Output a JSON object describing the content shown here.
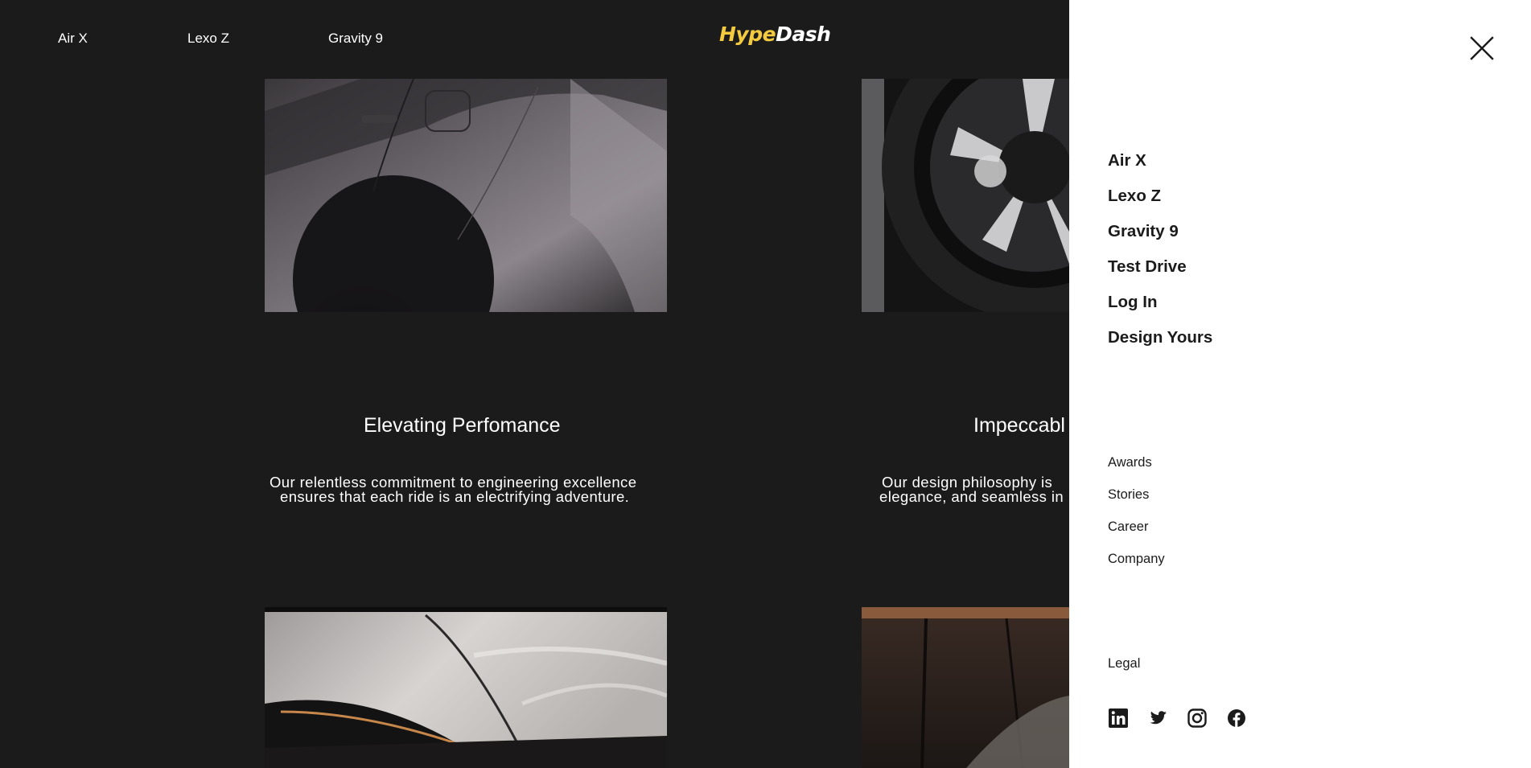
{
  "topnav": {
    "items": [
      {
        "label": "Air X"
      },
      {
        "label": "Lexo Z"
      },
      {
        "label": "Gravity 9"
      }
    ],
    "logo": {
      "part1": "Hype",
      "part2": "Dash"
    }
  },
  "features": [
    {
      "title": "Elevating Perfomance",
      "desc_line1": "Our relentless commitment to engineering excellence",
      "desc_line2": "ensures that each ride is an electrifying adventure."
    },
    {
      "title": "Impeccabl",
      "desc_line1": "Our design philosophy is",
      "desc_line2": "elegance, and seamless in"
    }
  ],
  "drawer": {
    "primary": [
      {
        "label": "Air X"
      },
      {
        "label": "Lexo Z"
      },
      {
        "label": "Gravity 9"
      },
      {
        "label": "Test Drive"
      },
      {
        "label": "Log In"
      },
      {
        "label": "Design Yours"
      }
    ],
    "secondary": [
      {
        "label": "Awards"
      },
      {
        "label": "Stories"
      },
      {
        "label": "Career"
      },
      {
        "label": "Company"
      }
    ],
    "legal": "Legal",
    "social": [
      {
        "icon": "linkedin-icon"
      },
      {
        "icon": "twitter-icon"
      },
      {
        "icon": "instagram-icon"
      },
      {
        "icon": "facebook-icon"
      }
    ]
  },
  "colors": {
    "background": "#1b1b1b",
    "drawer": "#ffffff",
    "logo_accent": "#f4cb3f",
    "text_dark": "#1b1b1b"
  }
}
